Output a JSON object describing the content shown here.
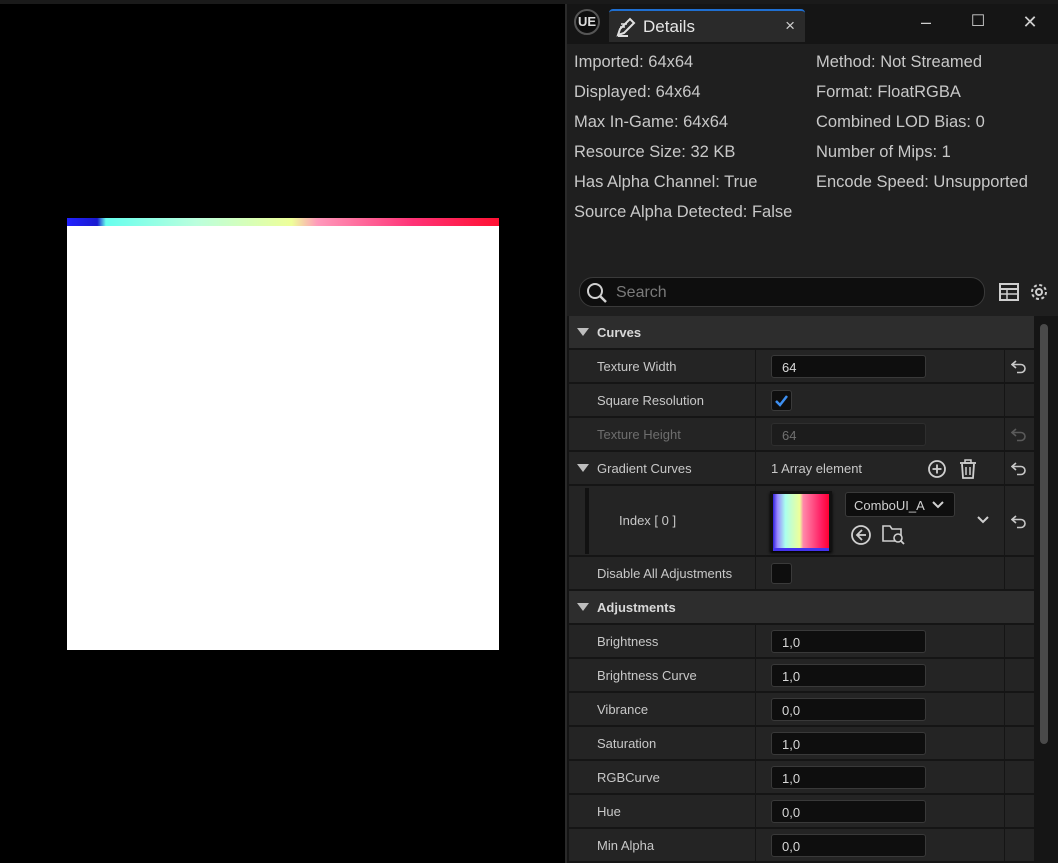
{
  "window": {
    "logo": "UE",
    "tab_title": "Details",
    "tab_close": "×",
    "min": "–",
    "max": "☐",
    "close": "✕"
  },
  "info": {
    "imported": "Imported: 64x64",
    "displayed": "Displayed: 64x64",
    "max_ingame": "Max In-Game: 64x64",
    "resource_size": "Resource Size: 32 KB",
    "has_alpha": "Has Alpha Channel: True",
    "source_alpha": "Source Alpha Detected: False",
    "method": "Method: Not Streamed",
    "format": "Format: FloatRGBA",
    "lod_bias": "Combined LOD Bias: 0",
    "mips": "Number of Mips: 1",
    "encode_speed": "Encode Speed: Unsupported"
  },
  "search": {
    "placeholder": "Search"
  },
  "curves": {
    "title": "Curves",
    "texture_width": {
      "label": "Texture Width",
      "value": "64"
    },
    "square_resolution": {
      "label": "Square Resolution",
      "checked": true
    },
    "texture_height": {
      "label": "Texture Height",
      "value": "64"
    },
    "gradient_curves": {
      "label": "Gradient Curves",
      "count": "1 Array element"
    },
    "index0": {
      "label": "Index [ 0 ]",
      "asset": "ComboUI_A"
    },
    "disable_all": {
      "label": "Disable All Adjustments",
      "checked": false
    }
  },
  "adjustments": {
    "title": "Adjustments",
    "rows": [
      {
        "label": "Brightness",
        "value": "1,0"
      },
      {
        "label": "Brightness Curve",
        "value": "1,0"
      },
      {
        "label": "Vibrance",
        "value": "0,0"
      },
      {
        "label": "Saturation",
        "value": "1,0"
      },
      {
        "label": "RGBCurve",
        "value": "1,0"
      },
      {
        "label": "Hue",
        "value": "0,0"
      },
      {
        "label": "Min Alpha",
        "value": "0,0"
      }
    ]
  }
}
